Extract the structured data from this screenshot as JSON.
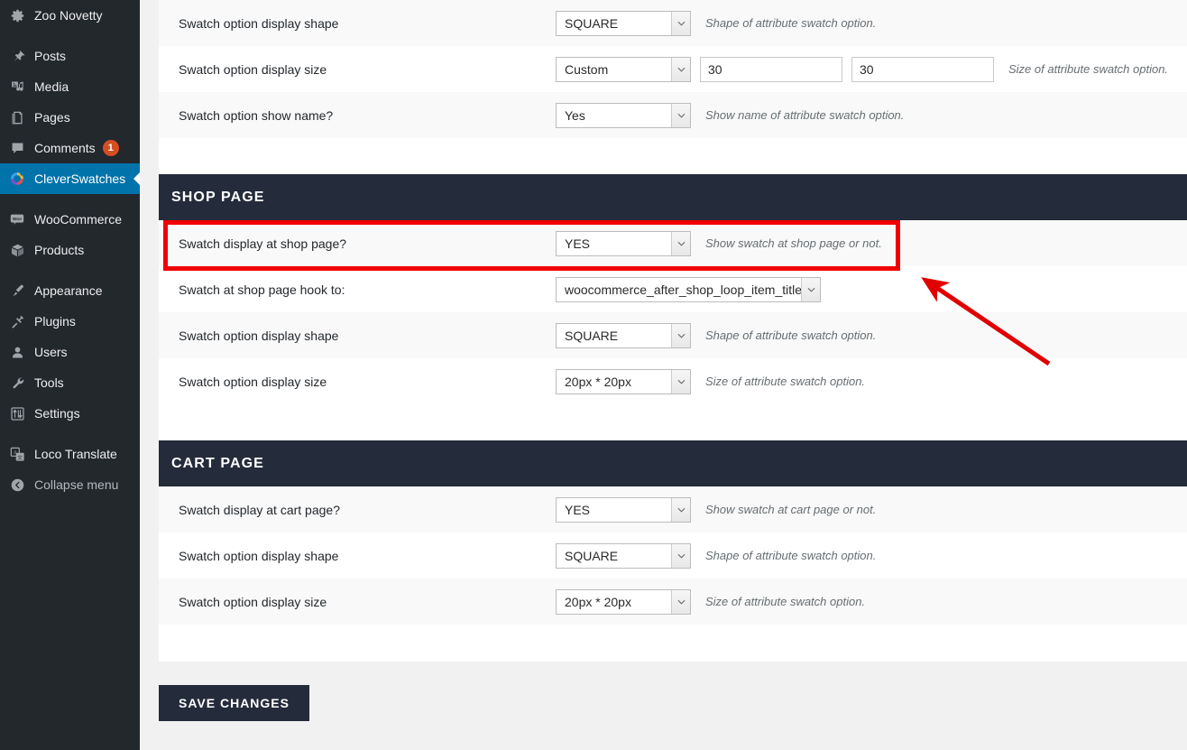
{
  "sidebar": {
    "items": [
      {
        "label": "Zoo Novetty",
        "icon": "gear-icon",
        "name": "site-name",
        "current": false
      },
      {
        "label": "Posts",
        "icon": "pin-icon",
        "name": "posts",
        "current": false
      },
      {
        "label": "Media",
        "icon": "media-icon",
        "name": "media",
        "current": false
      },
      {
        "label": "Pages",
        "icon": "pages-icon",
        "name": "pages",
        "current": false
      },
      {
        "label": "Comments",
        "icon": "comment-icon",
        "name": "comments",
        "current": false,
        "badge": "1"
      },
      {
        "label": "CleverSwatches",
        "icon": "cleverswatches-icon",
        "name": "cleverswatches",
        "current": true
      },
      {
        "label": "WooCommerce",
        "icon": "woocommerce-icon",
        "name": "woocommerce",
        "current": false
      },
      {
        "label": "Products",
        "icon": "products-icon",
        "name": "products",
        "current": false
      },
      {
        "label": "Appearance",
        "icon": "paintbrush-icon",
        "name": "appearance",
        "current": false
      },
      {
        "label": "Plugins",
        "icon": "plug-icon",
        "name": "plugins",
        "current": false
      },
      {
        "label": "Users",
        "icon": "user-icon",
        "name": "users",
        "current": false
      },
      {
        "label": "Tools",
        "icon": "wrench-icon",
        "name": "tools",
        "current": false
      },
      {
        "label": "Settings",
        "icon": "sliders-icon",
        "name": "settings",
        "current": false
      },
      {
        "label": "Loco Translate",
        "icon": "translate-icon",
        "name": "loco-translate",
        "current": false
      },
      {
        "label": "Collapse menu",
        "icon": "collapse-arrow-icon",
        "name": "collapse-menu",
        "current": false
      }
    ]
  },
  "top_rows": [
    {
      "label": "Swatch option display shape",
      "control": "select",
      "value": "SQUARE",
      "desc": "Shape of attribute swatch option."
    },
    {
      "label": "Swatch option display size",
      "control": "select-with-inputs",
      "value": "Custom",
      "input1": "30",
      "input2": "30",
      "desc": "Size of attribute swatch option."
    },
    {
      "label": "Swatch option show name?",
      "control": "select",
      "value": "Yes",
      "desc": "Show name of attribute swatch option."
    }
  ],
  "shop_section": {
    "title": "SHOP PAGE",
    "rows": [
      {
        "label": "Swatch display at shop page?",
        "control": "select",
        "value": "YES",
        "desc": "Show swatch at shop page or not.",
        "highlighted": true
      },
      {
        "label": "Swatch at shop page hook to:",
        "control": "select-wide",
        "value": "woocommerce_after_shop_loop_item_title",
        "desc": ""
      },
      {
        "label": "Swatch option display shape",
        "control": "select",
        "value": "SQUARE",
        "desc": "Shape of attribute swatch option."
      },
      {
        "label": "Swatch option display size",
        "control": "select",
        "value": "20px * 20px",
        "desc": "Size of attribute swatch option."
      }
    ]
  },
  "cart_section": {
    "title": "CART PAGE",
    "rows": [
      {
        "label": "Swatch display at cart page?",
        "control": "select",
        "value": "YES",
        "desc": "Show swatch at cart page or not."
      },
      {
        "label": "Swatch option display shape",
        "control": "select",
        "value": "SQUARE",
        "desc": "Shape of attribute swatch option."
      },
      {
        "label": "Swatch option display size",
        "control": "select",
        "value": "20px * 20px",
        "desc": "Size of attribute swatch option."
      }
    ]
  },
  "footer": {
    "save_label": "SAVE CHANGES"
  },
  "annotations": {
    "highlight_color": "#f00000",
    "arrow_color": "#e00000"
  },
  "colors": {
    "sidebar_bg": "#23282d",
    "current_menu": "#0073aa",
    "section_header": "#242b3a",
    "badge": "#d54e21",
    "row_alt": "#f9f9f9",
    "page_bg": "#f1f1f1"
  }
}
